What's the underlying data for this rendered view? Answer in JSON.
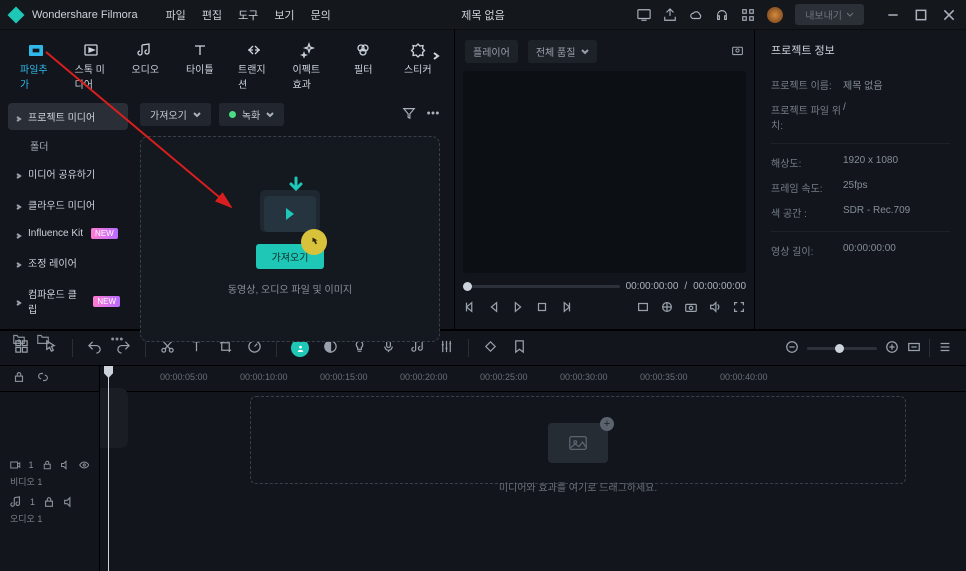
{
  "app": {
    "name": "Wondershare Filmora",
    "center_title": "제목 없음",
    "export_label": "내보내기"
  },
  "menu": [
    "파일",
    "편집",
    "도구",
    "보기",
    "문의"
  ],
  "media_tabs": [
    {
      "label": "파일추가",
      "k": "import",
      "active": true
    },
    {
      "label": "스톡 미디어",
      "k": "stock"
    },
    {
      "label": "오디오",
      "k": "audio"
    },
    {
      "label": "타이틀",
      "k": "title"
    },
    {
      "label": "트랜지션",
      "k": "transition"
    },
    {
      "label": "이펙트 효과",
      "k": "effect"
    },
    {
      "label": "필터",
      "k": "filter"
    },
    {
      "label": "스티커",
      "k": "sticker"
    }
  ],
  "sidebar": {
    "items": [
      {
        "label": "프로젝트 미디어",
        "active": true,
        "caret": true
      },
      {
        "label": "폴더",
        "sub": true
      },
      {
        "label": "미디어 공유하기",
        "caret": true
      },
      {
        "label": "클라우드 미디어",
        "caret": true
      },
      {
        "label": "Influence Kit",
        "caret": true,
        "badge": "NEW"
      },
      {
        "label": "조정 레이어",
        "caret": true
      },
      {
        "label": "컴파운드 클립",
        "caret": true,
        "badge": "NEW"
      }
    ]
  },
  "media_toolbar": {
    "import": "가져오기",
    "record": "녹화"
  },
  "drop": {
    "button": "가져오기",
    "hint": "동영상, 오디오 파일 및 이미지"
  },
  "preview": {
    "player": "플레이어",
    "quality": "전체 품질",
    "current": "00:00:00:00",
    "total": "00:00:00:00"
  },
  "info": {
    "title": "프로젝트 정보",
    "rows": [
      {
        "l": "프로젝트 이름:",
        "v": "제목 없음"
      },
      {
        "l": "프로젝트 파일 위치:",
        "v": "/"
      },
      {
        "l": "해상도:",
        "v": "1920 x 1080"
      },
      {
        "l": "프레임 속도:",
        "v": "25fps"
      },
      {
        "l": "색 공간 :",
        "v": "SDR - Rec.709"
      },
      {
        "l": "영상 길이:",
        "v": "00:00:00:00"
      }
    ]
  },
  "ruler": [
    "00:00:05:00",
    "00:00:10:00",
    "00:00:15:00",
    "00:00:20:00",
    "00:00:25:00",
    "00:00:30:00",
    "00:00:35:00",
    "00:00:40:00"
  ],
  "timeline": {
    "video_track": "비디오 1",
    "audio_track": "오디오 1",
    "drop_hint": "미디어와 효과를 여기로 드래그하세요."
  }
}
